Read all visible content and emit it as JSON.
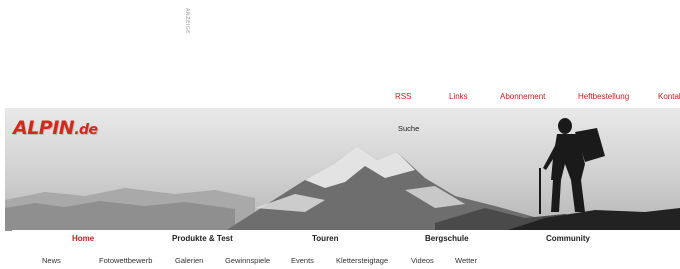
{
  "ad_label": "ANZEIGE",
  "top_links": [
    "RSS",
    "Links",
    "Abonnement",
    "Heftbestellung",
    "Kontakt"
  ],
  "banner": {
    "logo_main": "ALPIN",
    "logo_domain": ".de",
    "search_label": "Suche"
  },
  "main_nav": [
    "Home",
    "Produkte & Test",
    "Touren",
    "Bergschule",
    "Community"
  ],
  "active_nav": "Home",
  "sub_nav": [
    "News",
    "Fotowettbewerb",
    "Galerien",
    "Gewinnspiele",
    "Events",
    "Klettersteigtage",
    "Videos",
    "Wetter"
  ],
  "colors": {
    "accent": "#c81e1e",
    "logo": "#d22a1a"
  }
}
